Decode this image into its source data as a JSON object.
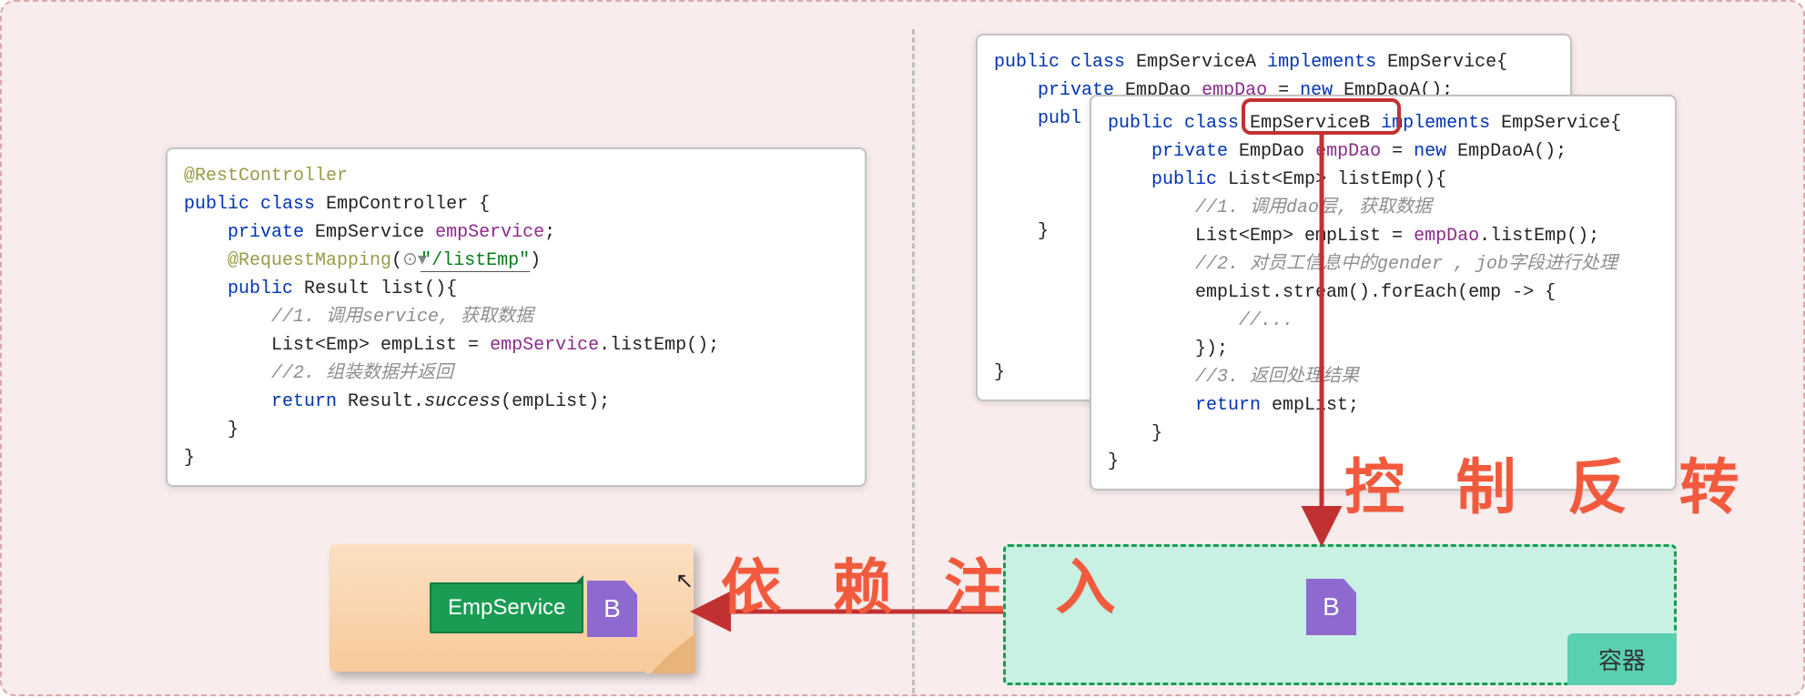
{
  "controller_code": "@RestController\npublic class EmpController {\n    private EmpService empService;\n    @RequestMapping(⊙▾\"/listEmp\")\n    public Result list(){\n        //1. 调用service, 获取数据\n        List<Emp> empList = empService.listEmp();\n        //2. 组装数据并返回\n        return Result.success(empList);\n    }\n}",
  "service_a_code": "public class EmpServiceA implements EmpService{\n    private EmpDao empDao = new EmpDaoA();\n    publ",
  "service_b_code": "public class EmpServiceB implements EmpService{\n    private EmpDao empDao = new EmpDaoA();\n    public List<Emp> listEmp(){\n        //1. 调用dao层, 获取数据\n        List<Emp> empList = empDao.listEmp();\n        //2. 对员工信息中的gender , job字段进行处理\n        empList.stream().forEach(emp -> {\n            //...\n        });\n        //3. 返回处理结果\n        return empList;\n    }\n}",
  "handwriting": {
    "di": "依 赖 注 入",
    "ioc": "控 制 反 转"
  },
  "labels": {
    "emp_service": "EmpService",
    "b_letter": "B",
    "container": "容器"
  },
  "diagram": {
    "description": "Spring IoC / DI 概念图：左侧 EmpController 依赖 EmpService；右侧 EmpServiceA / EmpServiceB 实现 EmpService。EmpServiceB 被红框标记，经“控制反转”放入容器，再经“依赖注入”注入到左侧控制器。",
    "arrows": [
      {
        "from": "EmpServiceB-class",
        "to": "container-box",
        "label": "控制反转",
        "color": "#c23131"
      },
      {
        "from": "container-box",
        "to": "empservice-consumer",
        "label": "依赖注入",
        "color": "#c23131"
      }
    ],
    "highlight": "EmpServiceB"
  }
}
